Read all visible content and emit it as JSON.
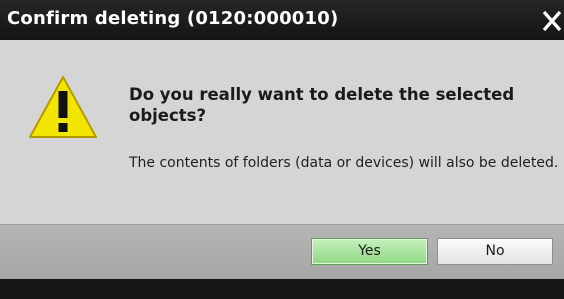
{
  "dialog": {
    "title": "Confirm deleting (0120:000010)",
    "close_icon": "close-icon",
    "warning_icon": "warning-triangle-icon",
    "question": "Do you really want to delete the selected objects?",
    "detail": "The contents of folders (data or devices) will also be deleted.",
    "yes_label": "Yes",
    "no_label": "No"
  },
  "colors": {
    "titlebar": "#1b1b1b",
    "content_bg": "#d5d5d5",
    "buttonbar_bg": "#ababab",
    "warning_yellow": "#f2e600",
    "default_button": "#a8e39c"
  }
}
